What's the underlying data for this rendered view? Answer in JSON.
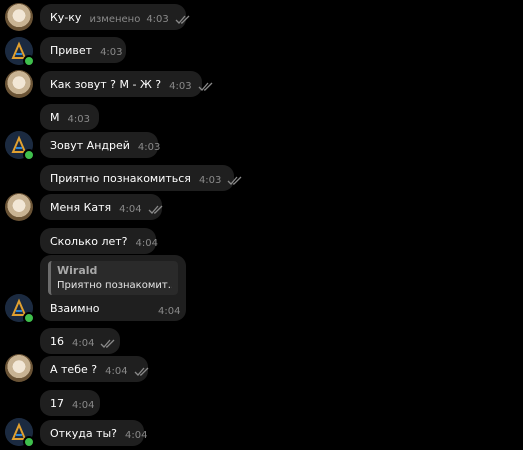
{
  "messages": [
    {
      "text": "Ку-ку",
      "edited": "изменено",
      "time": "4:03",
      "read": true
    },
    {
      "text": "Привет",
      "time": "4:03",
      "read": false
    },
    {
      "text": "Как зовут ? М - Ж ?",
      "time": "4:03",
      "read": true
    },
    {
      "text": "М",
      "time": "4:03",
      "read": false
    },
    {
      "text": "Зовут Андрей",
      "time": "4:03",
      "read": false
    },
    {
      "text": "Приятно познакомиться",
      "time": "4:03",
      "read": true
    },
    {
      "text": "Меня Катя",
      "time": "4:04",
      "read": true
    },
    {
      "text": "Сколько лет?",
      "time": "4:04",
      "read": false
    },
    {
      "reply_author": "Wirald",
      "reply_text": "Приятно познакомит...",
      "text": "Взаимно",
      "time": "4:04"
    },
    {
      "text": "16",
      "time": "4:04",
      "read": true
    },
    {
      "text": "А тебе ?",
      "time": "4:04",
      "read": true
    },
    {
      "text": "17",
      "time": "4:04",
      "read": false
    },
    {
      "text": "Откуда ты?",
      "time": "4:04",
      "read": false
    }
  ],
  "colors": {
    "background": "#000000",
    "bubble": "#1f1f1f",
    "meta_text": "#8a8a8a",
    "online": "#3fbf4c"
  },
  "icons": {
    "read_receipt": "double-check-icon",
    "avatar_female": "avatar-photo",
    "avatar_male": "avatar-logo-a"
  }
}
